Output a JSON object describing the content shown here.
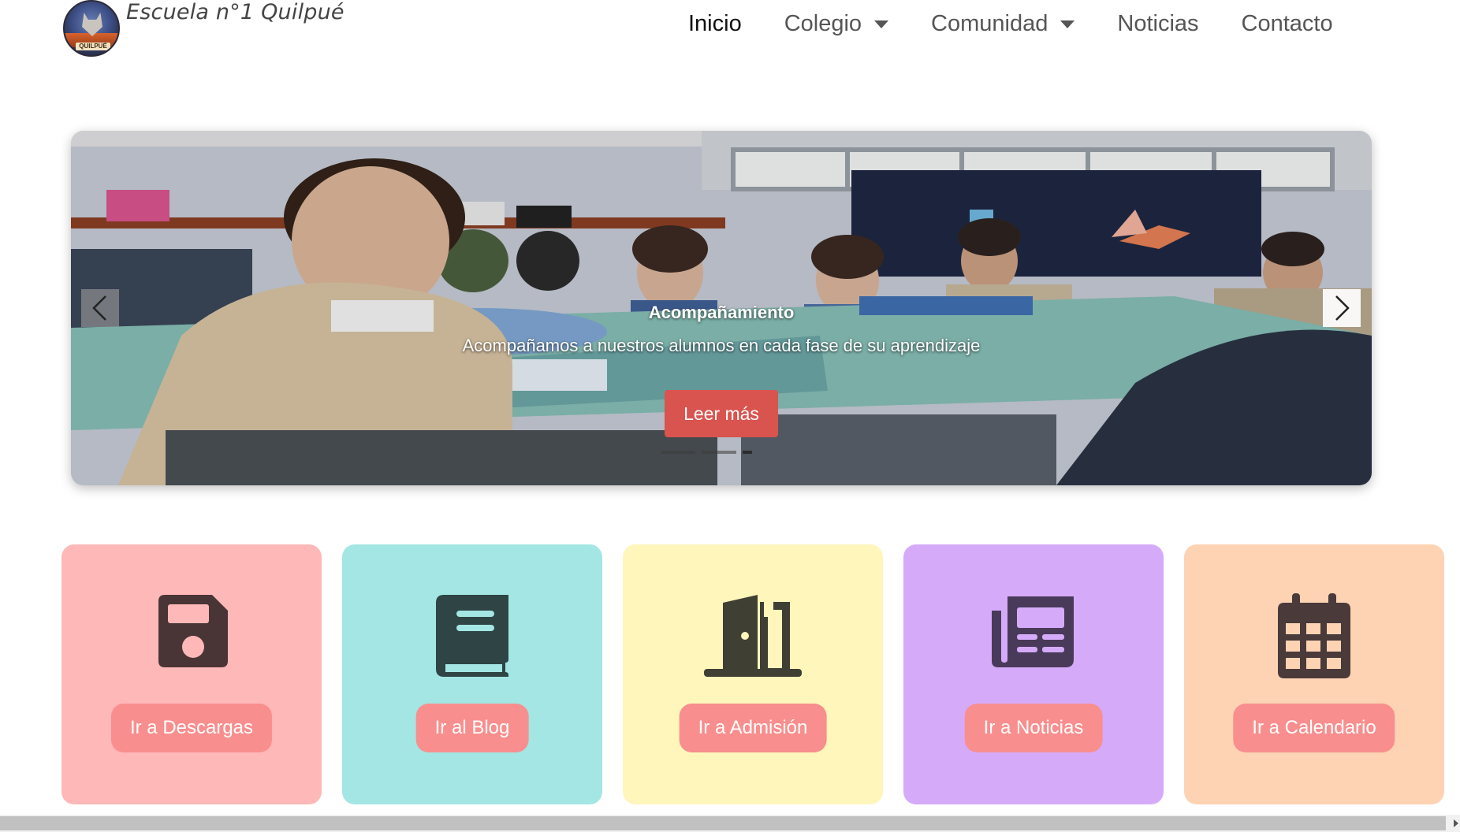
{
  "brand": {
    "name": "Escuela n°1 Quilpué",
    "logo_label": "QUILPUÉ"
  },
  "nav": {
    "items": [
      {
        "label": "Inicio",
        "active": true
      },
      {
        "label": "Colegio",
        "dropdown": true
      },
      {
        "label": "Comunidad",
        "dropdown": true
      },
      {
        "label": "Noticias"
      },
      {
        "label": "Contacto"
      }
    ]
  },
  "carousel": {
    "title": "Acompañamiento",
    "text": "Acompañamos a nuestros alumnos en cada fase de su aprendizaje",
    "button": "Leer más",
    "prev_icon": "chevron-left-icon",
    "next_icon": "chevron-right-icon",
    "slide_count": 3,
    "active_slide": 3
  },
  "cards": [
    {
      "button": "Ir a Descargas",
      "icon": "floppy-disk-icon",
      "bg": "#feb8b8"
    },
    {
      "button": "Ir al Blog",
      "icon": "book-icon",
      "bg": "#a3e6e4"
    },
    {
      "button": "Ir a Admisión",
      "icon": "door-open-icon",
      "bg": "#fef6bb"
    },
    {
      "button": "Ir a Noticias",
      "icon": "newspaper-icon",
      "bg": "#d5abf9"
    },
    {
      "button": "Ir a Calendario",
      "icon": "calendar-icon",
      "bg": "#fdd3b3"
    }
  ],
  "colors": {
    "accent": "#d9534f",
    "card_button": "#f98e8e",
    "icon": "#4a3a3a"
  }
}
